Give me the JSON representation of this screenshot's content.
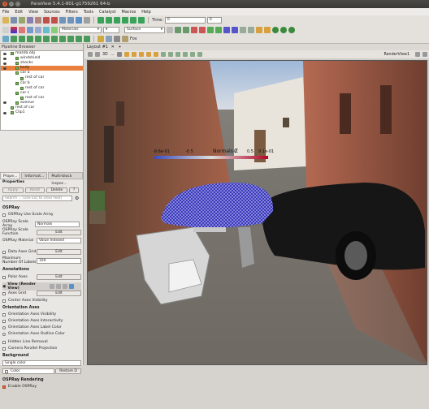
{
  "window": {
    "title": "ParaView 5.4.1-801-g1759261 64-b"
  },
  "menu": [
    "File",
    "Edit",
    "View",
    "Sources",
    "Filters",
    "Tools",
    "Catalyst",
    "Macros",
    "Help"
  ],
  "toolbar": {
    "time_label": "Time:",
    "time_value": "0",
    "array_value": "Materials",
    "representation_value": "Surface",
    "fov_label": "Fov"
  },
  "pipeline": {
    "header": "Pipeline Browser",
    "items": [
      {
        "label": "mazda.obj",
        "level": 0,
        "selected": false,
        "eye": true
      },
      {
        "label": "windshield",
        "level": 1,
        "selected": false,
        "eye": true
      },
      {
        "label": "shocks",
        "level": 1,
        "selected": false,
        "eye": true
      },
      {
        "label": "body",
        "level": 1,
        "selected": true,
        "eye": true
      },
      {
        "label": "car a",
        "level": 1,
        "selected": false,
        "eye": false
      },
      {
        "label": "rest of car",
        "level": 2,
        "selected": false,
        "eye": false
      },
      {
        "label": "car b",
        "level": 1,
        "selected": false,
        "eye": false
      },
      {
        "label": "rest of car",
        "level": 2,
        "selected": false,
        "eye": false
      },
      {
        "label": "car c",
        "level": 1,
        "selected": false,
        "eye": false
      },
      {
        "label": "rest of car",
        "level": 2,
        "selected": false,
        "eye": false
      },
      {
        "label": "avenue",
        "level": 1,
        "selected": false,
        "eye": true
      },
      {
        "label": "rest of car",
        "level": 0,
        "selected": false,
        "eye": false
      },
      {
        "label": "Clip1",
        "level": 0,
        "selected": false,
        "eye": true
      }
    ]
  },
  "tabs": [
    "Prope...",
    "Informat...",
    "Multi-block Inspec..."
  ],
  "properties": {
    "header": "Properties",
    "apply": "Apply",
    "reset": "Reset",
    "delete": "Delete",
    "help": "?",
    "search_placeholder": "Search ... (use Esc to clear text)",
    "ospray_section": "OSPRay",
    "use_scale_array": "OSPRay Use Scale Array",
    "scale_array_label": "OSPRay Scale Array",
    "scale_array_value": "Normals",
    "scale_function_label": "OSPRay Scale Function",
    "edit": "Edit",
    "material_label": "OSPRay Material",
    "material_value": "Value Indexed",
    "data_axes_grid": "Data Axes Grid",
    "max_labels_label": "Maximum Number Of Labels",
    "max_labels_value": "100",
    "annotations": "Annotations",
    "polar_axes": "Polar Axes",
    "view_label": "View (Render View)",
    "axes_grid": "Axes Grid",
    "center_axes": "Center Axes Visibility",
    "orientation_axes": "Orientation Axes",
    "oa_visibility": "Orientation Axes Visibility",
    "oa_interactivity": "Orientation Axes Interactivity",
    "oa_label_color": "Orientation Axes Label Color",
    "oa_outline_color": "Orientation Axes Outline Color",
    "hidden_line": "Hidden Line Removal",
    "camera_parallel": "Camera Parallel Projection",
    "background": "Background",
    "single_color": "Single color",
    "color_label": "Color",
    "restore_default": "Restore D",
    "ospray_rendering": "OSPRay Rendering",
    "enable_ospray": "Enable OSPRay"
  },
  "viewport": {
    "layout_tab": "Layout #1",
    "render_view_label": "RenderView1",
    "tools": [
      "3D",
      "…"
    ],
    "colorbar": {
      "title": "Normals Z",
      "ticks": [
        "-9.6e-01",
        "-0.5",
        "0",
        "0.5",
        "9.1e-01"
      ]
    }
  },
  "colors": {
    "selected_row": "#e9803e",
    "accent": "#3a78c8"
  }
}
